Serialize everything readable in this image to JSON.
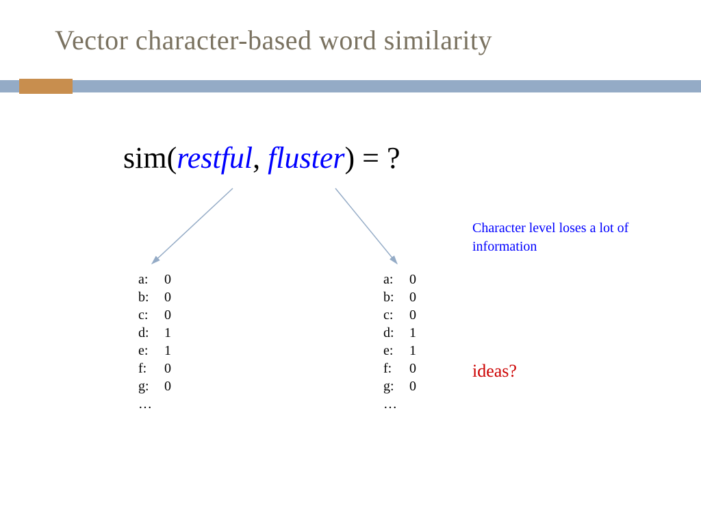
{
  "title": "Vector character-based word similarity",
  "formula": {
    "prefix": "sim(",
    "w1": "restful",
    "sep": ", ",
    "w2": "fluster",
    "suffix": ") = ?"
  },
  "vectors": {
    "left": [
      {
        "label": "a:",
        "value": "0"
      },
      {
        "label": "b:",
        "value": "0"
      },
      {
        "label": "c:",
        "value": "0"
      },
      {
        "label": "d:",
        "value": "1"
      },
      {
        "label": "e:",
        "value": "1"
      },
      {
        "label": "f:",
        "value": "0"
      },
      {
        "label": "g:",
        "value": "0"
      },
      {
        "label": "…",
        "value": ""
      }
    ],
    "right": [
      {
        "label": "a:",
        "value": "0"
      },
      {
        "label": "b:",
        "value": "0"
      },
      {
        "label": "c:",
        "value": "0"
      },
      {
        "label": "d:",
        "value": "1"
      },
      {
        "label": "e:",
        "value": "1"
      },
      {
        "label": "f:",
        "value": "0"
      },
      {
        "label": "g:",
        "value": "0"
      },
      {
        "label": "…",
        "value": ""
      }
    ]
  },
  "side_note": "Character level loses a lot of information",
  "ideas": "ideas?"
}
